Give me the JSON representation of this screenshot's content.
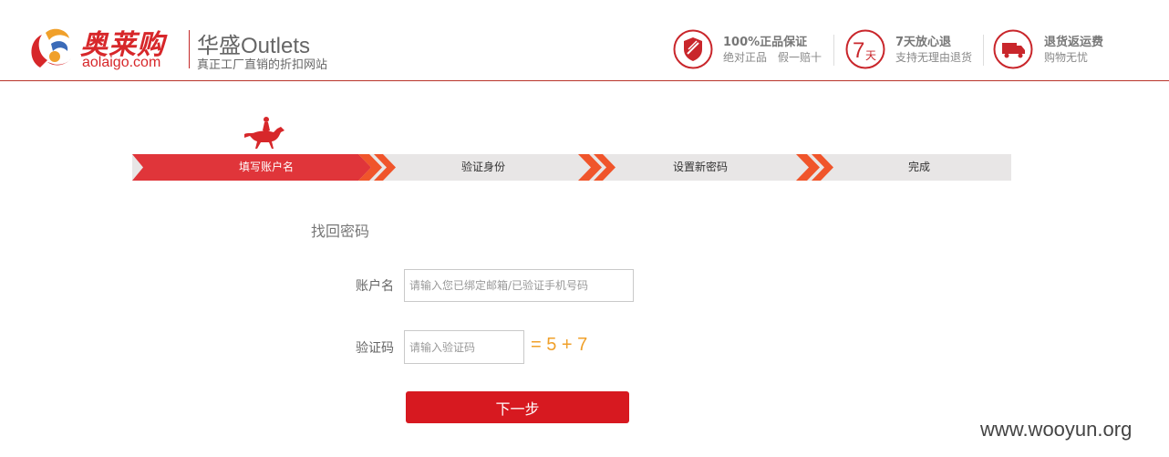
{
  "header": {
    "logo_cn": "奥莱购",
    "logo_en": "aolaigo.com",
    "brand_name": "华盛Outlets",
    "brand_tagline": "真正工厂直销的折扣网站",
    "promises": [
      {
        "icon": "shield-icon",
        "title": "100%正品保证",
        "subtitle": "绝对正品　假一赔十"
      },
      {
        "icon": "seven-day-icon",
        "title": "7天放心退",
        "subtitle": "支持无理由退货",
        "icon_text_num": "7",
        "icon_text_unit": "天"
      },
      {
        "icon": "truck-icon",
        "title": "退货返运费",
        "subtitle": "购物无忧"
      }
    ]
  },
  "steps": [
    {
      "label": "填写账户名",
      "state": "active"
    },
    {
      "label": "验证身份",
      "state": "todo"
    },
    {
      "label": "设置新密码",
      "state": "todo"
    },
    {
      "label": "完成",
      "state": "todo"
    }
  ],
  "form": {
    "title": "找回密码",
    "account_label": "账户名",
    "account_placeholder": "请输入您已绑定邮箱/已验证手机号码",
    "account_value": "",
    "code_label": "验证码",
    "code_placeholder": "请输入验证码",
    "code_value": "",
    "captcha_text": "= 5 + 7",
    "next_label": "下一步"
  },
  "colors": {
    "brand_red": "#d7272a",
    "step_active": "#e0353a",
    "step_arrow": "#f0552b",
    "step_bg": "#e8e6e6",
    "captcha": "#f0a02a",
    "button": "#d71920"
  },
  "watermark": "www.wooyun.org"
}
